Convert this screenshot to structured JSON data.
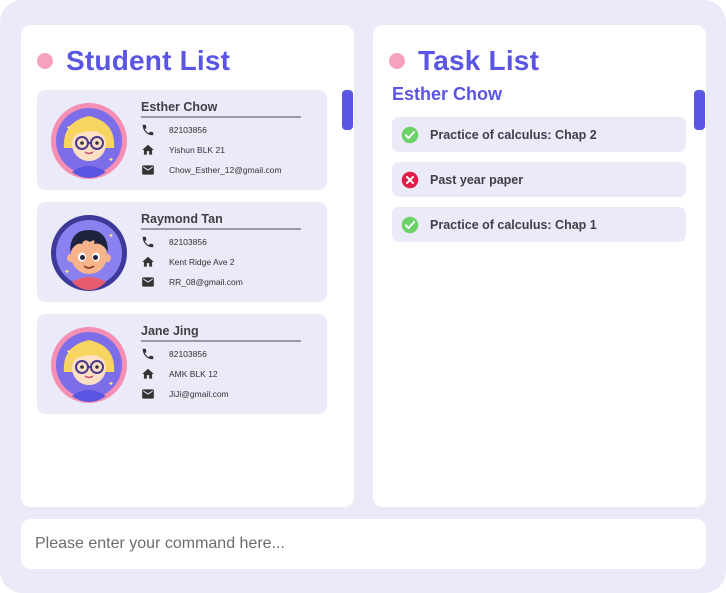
{
  "student_panel": {
    "title": "Student List",
    "students": [
      {
        "name": "Esther Chow",
        "phone": "82103856",
        "address": "Yishun BLK 21",
        "email": "Chow_Esther_12@gmail.com",
        "avatar": "blonde-girl-glasses-avatar"
      },
      {
        "name": "Raymond Tan",
        "phone": "82103856",
        "address": "Kent Ridge Ave 2",
        "email": "RR_08@gmail.com",
        "avatar": "dark-haired-boy-avatar"
      },
      {
        "name": "Jane Jing",
        "phone": "82103856",
        "address": "AMK BLK 12",
        "email": "JiJi@gmail.com",
        "avatar": "blonde-girl-glasses-avatar"
      }
    ]
  },
  "task_panel": {
    "title": "Task List",
    "selected_student": "Esther Chow",
    "tasks": [
      {
        "label": "Practice of calculus: Chap 2",
        "status": "done"
      },
      {
        "label": "Past year paper",
        "status": "not-done"
      },
      {
        "label": "Practice of calculus: Chap 1",
        "status": "done"
      }
    ]
  },
  "command": {
    "placeholder": "Please enter your command here...",
    "value": ""
  },
  "colors": {
    "accent": "#5a55e2",
    "dot": "#f7a1c0",
    "background": "#ebeaf9",
    "done": "#6cd169",
    "not_done": "#e11d48"
  }
}
